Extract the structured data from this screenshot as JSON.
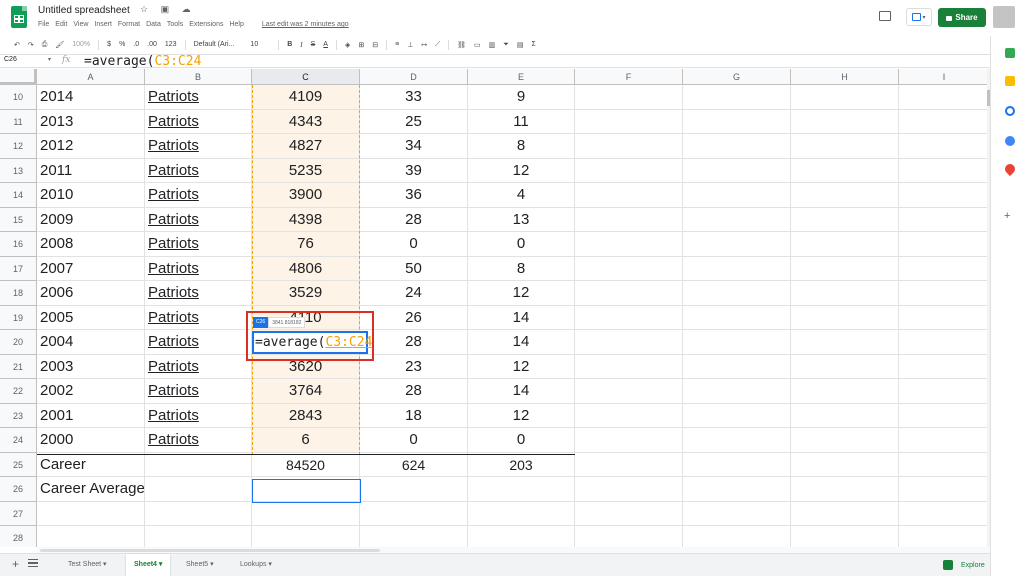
{
  "app": {
    "title": "Untitled spreadsheet",
    "title_icons": "☆ ▣ ☁",
    "menu": [
      "File",
      "Edit",
      "View",
      "Insert",
      "Format",
      "Data",
      "Tools",
      "Extensions",
      "Help"
    ],
    "last_edit": "Last edit was 2 minutes ago",
    "share_label": "Share"
  },
  "toolbar": {
    "zoom": "100%",
    "currency": "$",
    "percent": "%",
    "dec_less": ".0",
    "dec_more": ".00",
    "format_more": "123",
    "font": "Default (Ari...",
    "font_size": "10"
  },
  "formula_bar": {
    "cell_ref": "C26",
    "fx": "fx",
    "formula_prefix": "=average(",
    "formula_range": "C3:C24"
  },
  "columns": [
    "A",
    "B",
    "C",
    "D",
    "E",
    "F",
    "G",
    "H",
    "I"
  ],
  "rows": [
    {
      "n": "10",
      "a": "2014",
      "b": "Patriots",
      "c": "4109",
      "d": "33",
      "e": "9"
    },
    {
      "n": "11",
      "a": "2013",
      "b": "Patriots",
      "c": "4343",
      "d": "25",
      "e": "11"
    },
    {
      "n": "12",
      "a": "2012",
      "b": "Patriots",
      "c": "4827",
      "d": "34",
      "e": "8"
    },
    {
      "n": "13",
      "a": "2011",
      "b": "Patriots",
      "c": "5235",
      "d": "39",
      "e": "12"
    },
    {
      "n": "14",
      "a": "2010",
      "b": "Patriots",
      "c": "3900",
      "d": "36",
      "e": "4"
    },
    {
      "n": "15",
      "a": "2009",
      "b": "Patriots",
      "c": "4398",
      "d": "28",
      "e": "13"
    },
    {
      "n": "16",
      "a": "2008",
      "b": "Patriots",
      "c": "76",
      "d": "0",
      "e": "0"
    },
    {
      "n": "17",
      "a": "2007",
      "b": "Patriots",
      "c": "4806",
      "d": "50",
      "e": "8"
    },
    {
      "n": "18",
      "a": "2006",
      "b": "Patriots",
      "c": "3529",
      "d": "24",
      "e": "12"
    },
    {
      "n": "19",
      "a": "2005",
      "b": "Patriots",
      "c": "4110",
      "d": "26",
      "e": "14"
    },
    {
      "n": "20",
      "a": "2004",
      "b": "Patriots",
      "c": "",
      "d": "28",
      "e": "14"
    },
    {
      "n": "21",
      "a": "2003",
      "b": "Patriots",
      "c": "3620",
      "d": "23",
      "e": "12"
    },
    {
      "n": "22",
      "a": "2002",
      "b": "Patriots",
      "c": "3764",
      "d": "28",
      "e": "14"
    },
    {
      "n": "23",
      "a": "2001",
      "b": "Patriots",
      "c": "2843",
      "d": "18",
      "e": "12"
    },
    {
      "n": "24",
      "a": "2000",
      "b": "Patriots",
      "c": "6",
      "d": "0",
      "e": "0"
    },
    {
      "n": "25",
      "a": "Career",
      "b": "",
      "c": "84520",
      "d": "624",
      "e": "203"
    },
    {
      "n": "26",
      "a": "Career Average",
      "b": "",
      "c": "",
      "d": "",
      "e": ""
    },
    {
      "n": "27",
      "a": "",
      "b": "",
      "c": "",
      "d": "",
      "e": ""
    },
    {
      "n": "28",
      "a": "",
      "b": "",
      "c": "",
      "d": "",
      "e": ""
    }
  ],
  "editor": {
    "tip_ref": "C26",
    "tip_value": "3841.818182",
    "formula_prefix": "=average(",
    "formula_range": "C3:C24"
  },
  "sheets": {
    "tabs": [
      "Test Sheet",
      "Sheet4",
      "Sheet5",
      "Lookups"
    ],
    "active": "Sheet4",
    "explore_label": "Explore"
  },
  "colors": {
    "accent_green": "#188038",
    "range_orange": "#f4a300",
    "selection_blue": "#1a73e8",
    "annotation_red": "#d93025"
  }
}
